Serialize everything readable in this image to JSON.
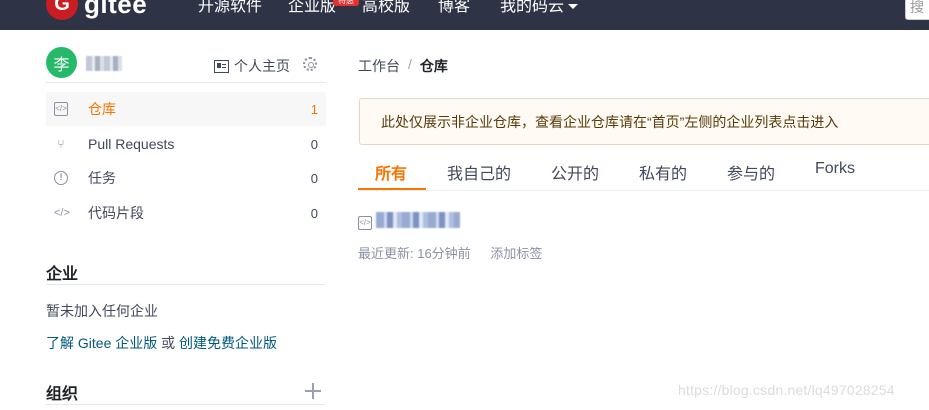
{
  "topnav": {
    "logo_letter": "G",
    "logo_text": "gitee",
    "items": [
      "开源软件",
      "企业版",
      "高校版",
      "博客",
      "我的码云"
    ],
    "enterprise_badge": "特惠",
    "search_placeholder": "搜"
  },
  "user": {
    "avatar_initial": "李",
    "homepage_label": "个人主页"
  },
  "sidebar": {
    "items": [
      {
        "label": "仓库",
        "count": "1",
        "icon": "repo-icon",
        "active": true
      },
      {
        "label": "Pull Requests",
        "count": "0",
        "icon": "pull-request-icon"
      },
      {
        "label": "任务",
        "count": "0",
        "icon": "issue-icon"
      },
      {
        "label": "代码片段",
        "count": "0",
        "icon": "code-snippet-icon"
      }
    ],
    "enterprise": {
      "title": "企业",
      "empty_text": "暂未加入任何企业",
      "learn_link": "了解 Gitee 企业版",
      "or_text": "或",
      "create_link": "创建免费企业版"
    },
    "org": {
      "title": "组织"
    }
  },
  "main": {
    "breadcrumb": {
      "root": "工作台",
      "sep": "/",
      "current": "仓库"
    },
    "notice": "此处仅展示非企业仓库，查看企业仓库请在“首页”左侧的企业列表点击进入",
    "tabs": [
      "所有",
      "我自己的",
      "公开的",
      "私有的",
      "参与的",
      "Forks"
    ],
    "repo": {
      "updated": "最近更新: 16分钟前",
      "add_tag": "添加标签"
    }
  },
  "watermark": "https://blog.csdn.net/lq497028254",
  "colors": {
    "accent": "#fe7300",
    "topbar": "#2e3346",
    "avatar": "#26b96a"
  }
}
